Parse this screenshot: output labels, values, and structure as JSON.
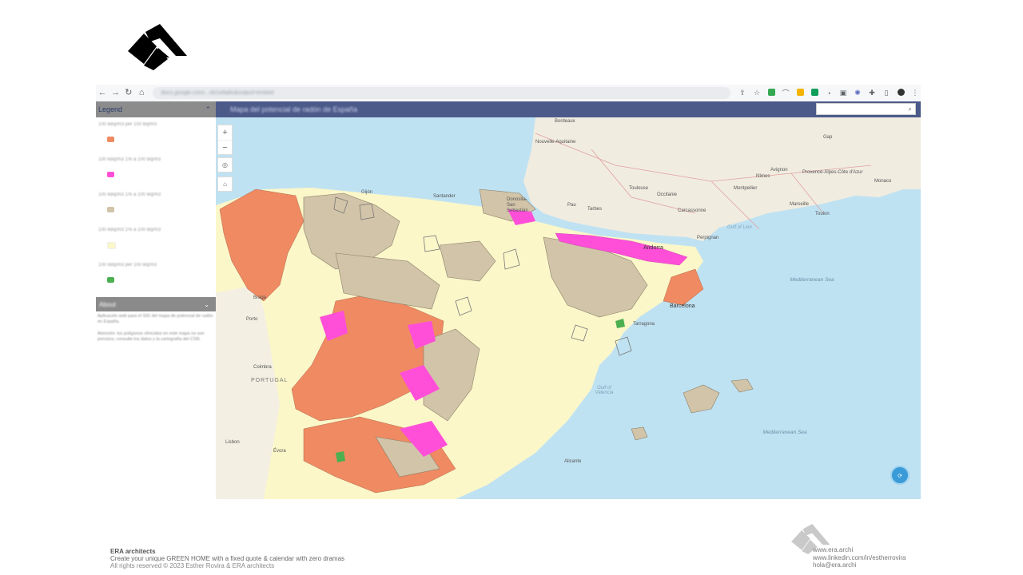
{
  "browser": {
    "url": "docs.google.com/.../d/1e9a8c&output=embed",
    "nav_icons": [
      "back-icon",
      "forward-icon",
      "reload-icon",
      "home-icon"
    ]
  },
  "legend": {
    "title": "Legend",
    "items": [
      {
        "text": "100 kBq/m3 per 100 Bq/m3",
        "color": "#ef8a62"
      },
      {
        "text": "100 kBq/m3 1% a 100 Bq/m3",
        "color": "#ff4fd8"
      },
      {
        "text": "100 kBq/m3 1% a 100 Bq/m3",
        "color": "#d2c4a8"
      },
      {
        "text": "100 kBq/m3 1% a 100 Bq/m3",
        "color": "#fbf7c9"
      },
      {
        "text": "100 kBq/m3 per 100 Bq/m3",
        "color": "#4caf50"
      }
    ]
  },
  "about": {
    "title": "About",
    "paragraphs": [
      "Aplicación web para el SIG del mapa de potencial de radón en España.",
      "Atención: los polígonos ofrecidos en este mapa no son precisos; consulte los datos y la cartografía del CSN."
    ]
  },
  "map": {
    "title": "Mapa del potencial de radón de España",
    "labels": {
      "bordeaux": "Bordeaux",
      "nouvelle_aquitaine": "Nouvelle-Aquitaine",
      "toulouse": "Toulouse",
      "occitanie": "Occitanie",
      "montpellier": "Montpellier",
      "avignon": "Avignon",
      "provence": "Provence-Alpes-Côte d'Azur",
      "marseille": "Marseille",
      "toulon": "Toulon",
      "monaco": "Monaco",
      "gap": "Gap",
      "nimes": "Nîmes",
      "carcassonne": "Carcassonne",
      "perpignan": "Perpignan",
      "gulf_lion": "Gulf of Lion",
      "andorra": "Andorra",
      "gijon": "Gijón",
      "santander": "Santander",
      "donostia": "Donostia-San Sebastián",
      "pau": "Pau",
      "tarbes": "Tarbes",
      "braga": "Braga",
      "porto": "Porto",
      "coimbra": "Coimbra",
      "portugal": "PORTUGAL",
      "lisbon": "Lisbon",
      "evora": "Évora",
      "barcelona": "Barcelona",
      "tarragona": "Tarragona",
      "gulf_valencia": "Gulf of Valencia",
      "med_sea_1": "Mediterranean Sea",
      "med_sea_2": "Mediterranean Sea",
      "alicante": "Alicante"
    }
  },
  "footer": {
    "brand": "ERA architects",
    "tagline": "Create your unique GREEN HOME with a fixed quote & calendar with zero dramas",
    "rights": "All rights reserved © 2023 Esther Rovira & ERA architects",
    "website": "www.era.archi",
    "linkedin": "www.linkedin.com/in/estherrovira",
    "email": "hola@era.archi"
  },
  "colors": {
    "title_bar": "#4c5a8a",
    "sea": "#bfe2f2",
    "land_france": "#f1ece0",
    "zone_orange": "#ef8a62",
    "zone_pink": "#ff4fd8",
    "zone_tan": "#d2c4a8",
    "zone_cream": "#fbf7c9"
  }
}
